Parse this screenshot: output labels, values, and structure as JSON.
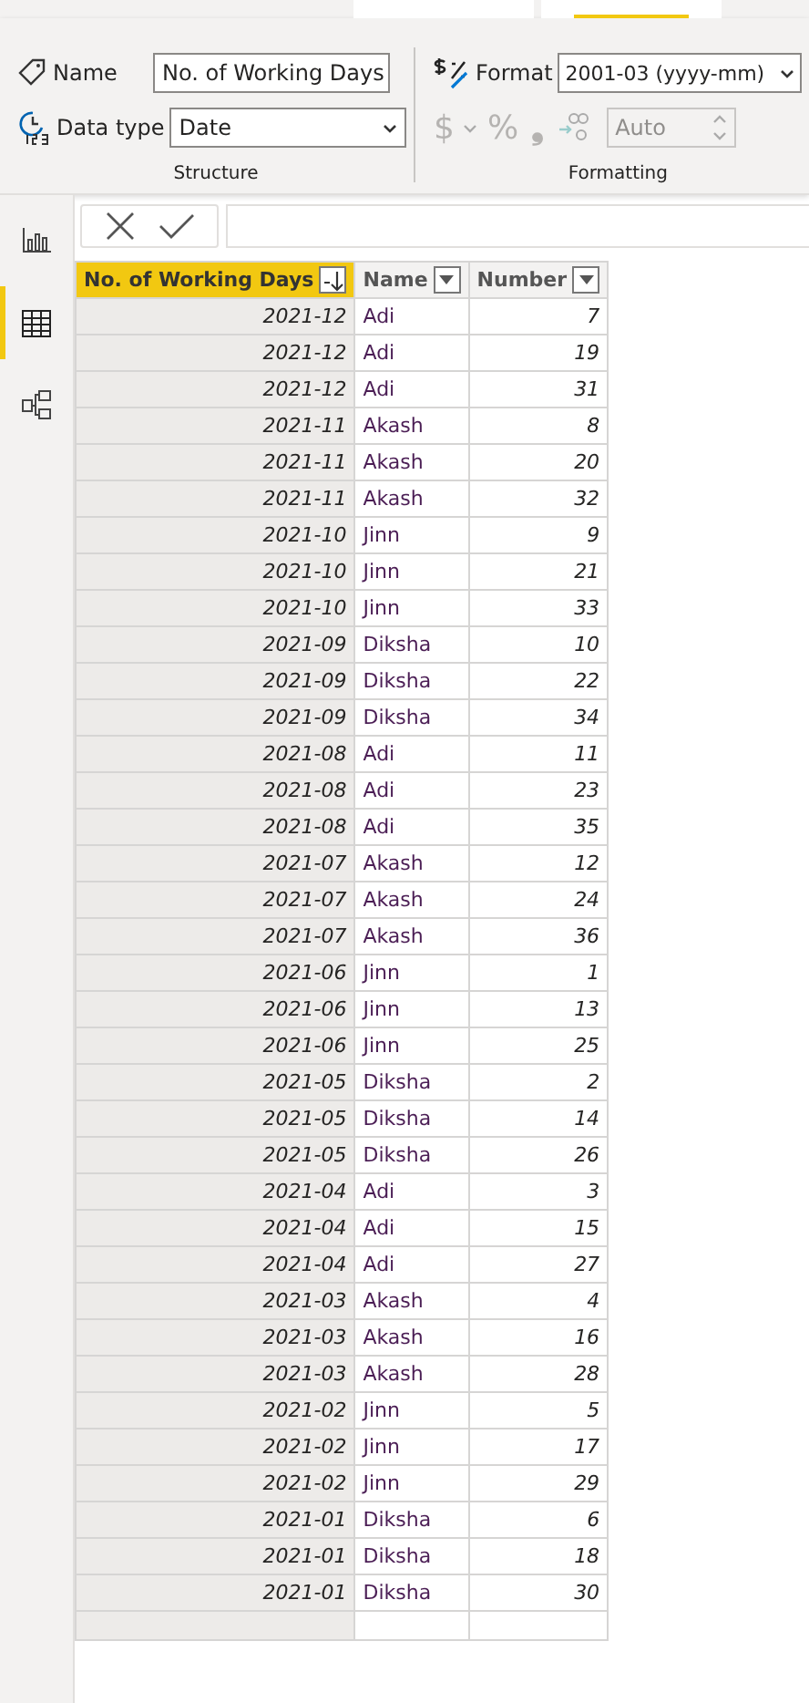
{
  "ribbon_tabs": [
    {
      "selected": false
    },
    {
      "selected": true
    }
  ],
  "structure": {
    "name_label": "Name",
    "name_value": "No. of Working Days",
    "datatype_label": "Data type",
    "datatype_value": "Date",
    "group_label": "Structure"
  },
  "formatting": {
    "format_label": "Format",
    "format_value": "2001-03 (yyyy-mm)",
    "currency_symbol": "$",
    "percent_symbol": "%",
    "comma_symbol": "❟",
    "decimals_placeholder": "Auto",
    "group_label": "Formatting"
  },
  "sidebar": [
    {
      "kind": "report",
      "selected": false
    },
    {
      "kind": "data",
      "selected": true
    },
    {
      "kind": "model",
      "selected": false
    }
  ],
  "table": {
    "columns": [
      {
        "label": "No. of Working Days",
        "selected": true,
        "sorted": true
      },
      {
        "label": "Name",
        "selected": false,
        "sorted": false
      },
      {
        "label": "Number",
        "selected": false,
        "sorted": false
      }
    ],
    "rows": [
      [
        "2021-12",
        "Adi",
        "7"
      ],
      [
        "2021-12",
        "Adi",
        "19"
      ],
      [
        "2021-12",
        "Adi",
        "31"
      ],
      [
        "2021-11",
        "Akash",
        "8"
      ],
      [
        "2021-11",
        "Akash",
        "20"
      ],
      [
        "2021-11",
        "Akash",
        "32"
      ],
      [
        "2021-10",
        "Jinn",
        "9"
      ],
      [
        "2021-10",
        "Jinn",
        "21"
      ],
      [
        "2021-10",
        "Jinn",
        "33"
      ],
      [
        "2021-09",
        "Diksha",
        "10"
      ],
      [
        "2021-09",
        "Diksha",
        "22"
      ],
      [
        "2021-09",
        "Diksha",
        "34"
      ],
      [
        "2021-08",
        "Adi",
        "11"
      ],
      [
        "2021-08",
        "Adi",
        "23"
      ],
      [
        "2021-08",
        "Adi",
        "35"
      ],
      [
        "2021-07",
        "Akash",
        "12"
      ],
      [
        "2021-07",
        "Akash",
        "24"
      ],
      [
        "2021-07",
        "Akash",
        "36"
      ],
      [
        "2021-06",
        "Jinn",
        "1"
      ],
      [
        "2021-06",
        "Jinn",
        "13"
      ],
      [
        "2021-06",
        "Jinn",
        "25"
      ],
      [
        "2021-05",
        "Diksha",
        "2"
      ],
      [
        "2021-05",
        "Diksha",
        "14"
      ],
      [
        "2021-05",
        "Diksha",
        "26"
      ],
      [
        "2021-04",
        "Adi",
        "3"
      ],
      [
        "2021-04",
        "Adi",
        "15"
      ],
      [
        "2021-04",
        "Adi",
        "27"
      ],
      [
        "2021-03",
        "Akash",
        "4"
      ],
      [
        "2021-03",
        "Akash",
        "16"
      ],
      [
        "2021-03",
        "Akash",
        "28"
      ],
      [
        "2021-02",
        "Jinn",
        "5"
      ],
      [
        "2021-02",
        "Jinn",
        "17"
      ],
      [
        "2021-02",
        "Jinn",
        "29"
      ],
      [
        "2021-01",
        "Diksha",
        "6"
      ],
      [
        "2021-01",
        "Diksha",
        "18"
      ],
      [
        "2021-01",
        "Diksha",
        "30"
      ]
    ]
  }
}
